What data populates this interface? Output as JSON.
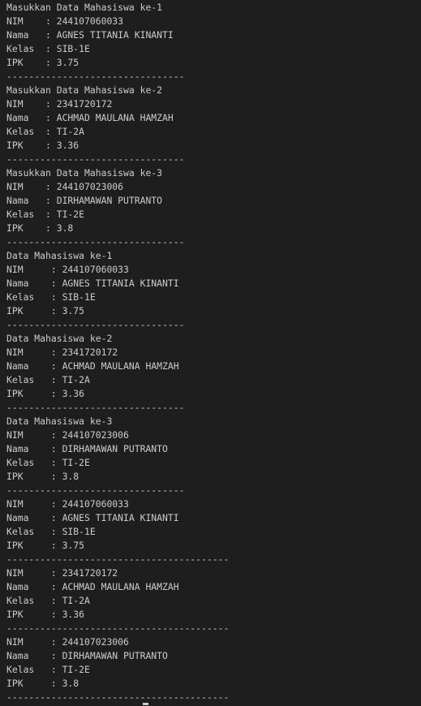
{
  "terminal": {
    "lines": [
      "Masukkan Data Mahasiswa ke-1",
      "NIM    : 244107060033",
      "Nama   : AGNES TITANIA KINANTI",
      "Kelas  : SIB-1E",
      "IPK    : 3.75",
      "--------------------------------",
      "Masukkan Data Mahasiswa ke-2",
      "NIM    : 2341720172",
      "Nama   : ACHMAD MAULANA HAMZAH",
      "Kelas  : TI-2A",
      "IPK    : 3.36",
      "--------------------------------",
      "Masukkan Data Mahasiswa ke-3",
      "NIM    : 244107023006",
      "Nama   : DIRHAMAWAN PUTRANTO",
      "Kelas  : TI-2E",
      "IPK    : 3.8",
      "--------------------------------",
      "Data Mahasiswa ke-1",
      "NIM     : 244107060033",
      "Nama    : AGNES TITANIA KINANTI",
      "Kelas   : SIB-1E",
      "IPK     : 3.75",
      "--------------------------------",
      "Data Mahasiswa ke-2",
      "NIM     : 2341720172",
      "Nama    : ACHMAD MAULANA HAMZAH",
      "Kelas   : TI-2A",
      "IPK     : 3.36",
      "--------------------------------",
      "Data Mahasiswa ke-3",
      "NIM     : 244107023006",
      "Nama    : DIRHAMAWAN PUTRANTO",
      "Kelas   : TI-2E",
      "IPK     : 3.8",
      "--------------------------------",
      "NIM     : 244107060033",
      "Nama    : AGNES TITANIA KINANTI",
      "Kelas   : SIB-1E",
      "IPK     : 3.75",
      "----------------------------------------",
      "NIM     : 2341720172",
      "Nama    : ACHMAD MAULANA HAMZAH",
      "Kelas   : TI-2A",
      "IPK     : 3.36",
      "----------------------------------------",
      "NIM     : 244107023006",
      "Nama    : DIRHAMAWAN PUTRANTO",
      "Kelas   : TI-2E",
      "IPK     : 3.8",
      "----------------------------------------"
    ]
  }
}
